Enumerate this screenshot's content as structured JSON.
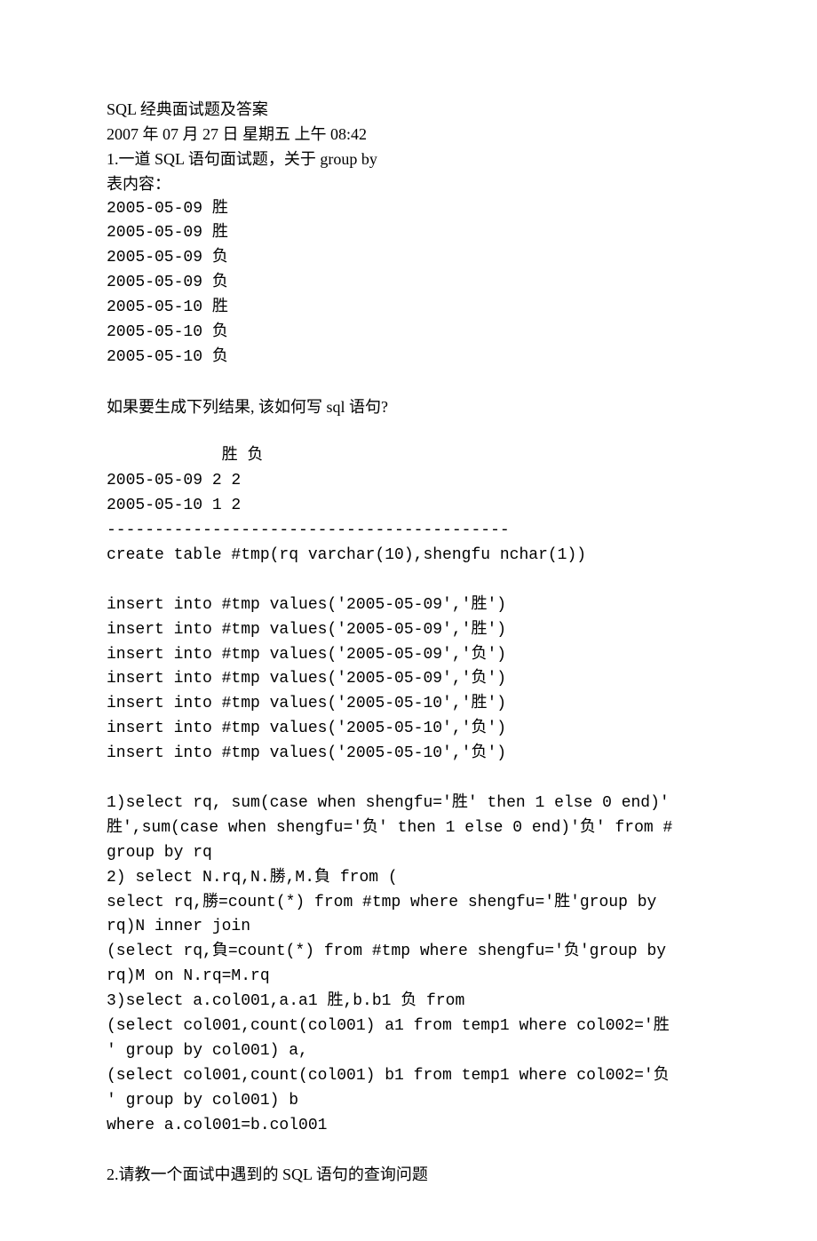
{
  "doc": {
    "title": "SQL 经典面试题及答案",
    "dateline": "2007 年 07 月 27 日 星期五 上午 08:42",
    "q1_intro": "1.一道 SQL 语句面试题，关于 group by",
    "q1_table_header": "表内容：",
    "q1_rows": [
      "2005-05-09 胜",
      "2005-05-09 胜",
      "2005-05-09 负",
      "2005-05-09 负",
      "2005-05-10 胜",
      "2005-05-10 负",
      "2005-05-10 负"
    ],
    "q1_question": "如果要生成下列结果, 该如何写 sql 语句?",
    "q1_result_header": "            胜 负",
    "q1_result_rows": [
      "2005-05-09 2 2",
      "2005-05-10 1 2"
    ],
    "q1_divider": "------------------------------------------",
    "q1_create": "create table #tmp(rq varchar(10),shengfu nchar(1))",
    "q1_inserts": [
      "insert into #tmp values('2005-05-09','胜')",
      "insert into #tmp values('2005-05-09','胜')",
      "insert into #tmp values('2005-05-09','负')",
      "insert into #tmp values('2005-05-09','负')",
      "insert into #tmp values('2005-05-10','胜')",
      "insert into #tmp values('2005-05-10','负')",
      "insert into #tmp values('2005-05-10','负')"
    ],
    "q1_sol1_l1": "1)select rq, sum(case when shengfu='胜' then 1 else 0 end)'",
    "q1_sol1_l2": "胜',sum(case when shengfu='负' then 1 else 0 end)'负' from #",
    "q1_sol1_l3": "group by rq",
    "q1_sol2_l1": "2) select N.rq,N.勝,M.負 from (",
    "q1_sol2_l2": "select rq,勝=count(*) from #tmp where shengfu='胜'group by",
    "q1_sol2_l3": "rq)N inner join",
    "q1_sol2_l4": "(select rq,負=count(*) from #tmp where shengfu='负'group by",
    "q1_sol2_l5": "rq)M on N.rq=M.rq",
    "q1_sol3_l1": "3)select a.col001,a.a1 胜,b.b1 负 from",
    "q1_sol3_l2": "(select col001,count(col001) a1 from temp1 where col002='胜",
    "q1_sol3_l3": "' group by col001) a,",
    "q1_sol3_l4": "(select col001,count(col001) b1 from temp1 where col002='负",
    "q1_sol3_l5": "' group by col001) b",
    "q1_sol3_l6": "where a.col001=b.col001",
    "q2_intro": "2.请教一个面试中遇到的 SQL 语句的查询问题"
  }
}
